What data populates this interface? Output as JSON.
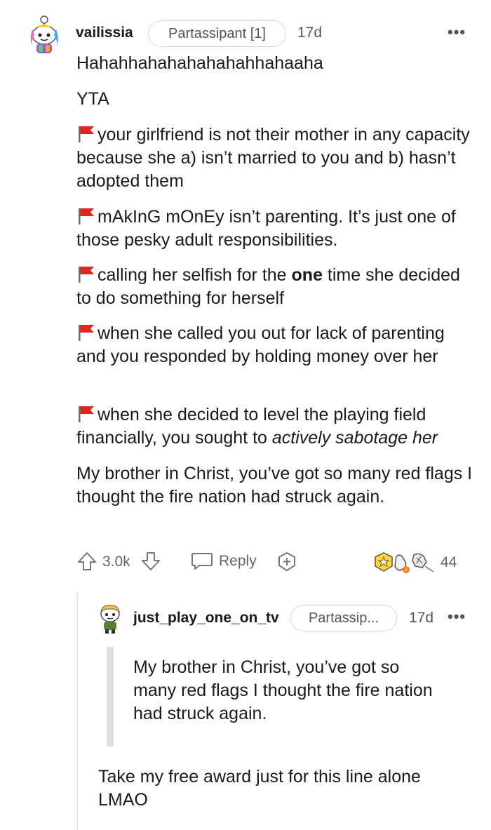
{
  "comment": {
    "username": "vailissia",
    "flair": "Partassipant [1]",
    "time": "17d",
    "more": "•••",
    "lines": {
      "laugh": "Hahahhahahahahahahhahaaha",
      "verdict": "YTA"
    },
    "flag1": "your girlfriend is not their mother in any capacity because she a) isn’t married to you and b) hasn’t adopted them",
    "flag2": "mAkInG mOnEy isn’t parenting. It’s just one of those pesky adult responsibilities.",
    "flag3": {
      "before": "calling her selfish for the ",
      "bold": "one",
      "after": " time she decided to do something for herself"
    },
    "flag4": "when she called you out for lack of parenting and you responded by holding money over her",
    "flag5": {
      "before": "when she decided to level the playing field financially, you sought to ",
      "italic": "actively sabotage her"
    },
    "closing": "My brother in Christ, you’ve got so many red flags I thought the fire nation had struck again.",
    "actions": {
      "score": "3.0k",
      "reply": "Reply",
      "awards_count": "44"
    }
  },
  "reply_comment": {
    "username": "just_play_one_on_tv",
    "flair": "Partassip...",
    "time": "17d",
    "more": "•••",
    "quote": "My brother in Christ, you’ve got so many red flags I thought the fire nation had struck again.",
    "body": "Take my free award just for this line alone LMAO"
  },
  "colors": {
    "flag_red": "#e8231f",
    "quote_bar": "#e0e0e0",
    "thread_line": "#e6e6e6"
  }
}
